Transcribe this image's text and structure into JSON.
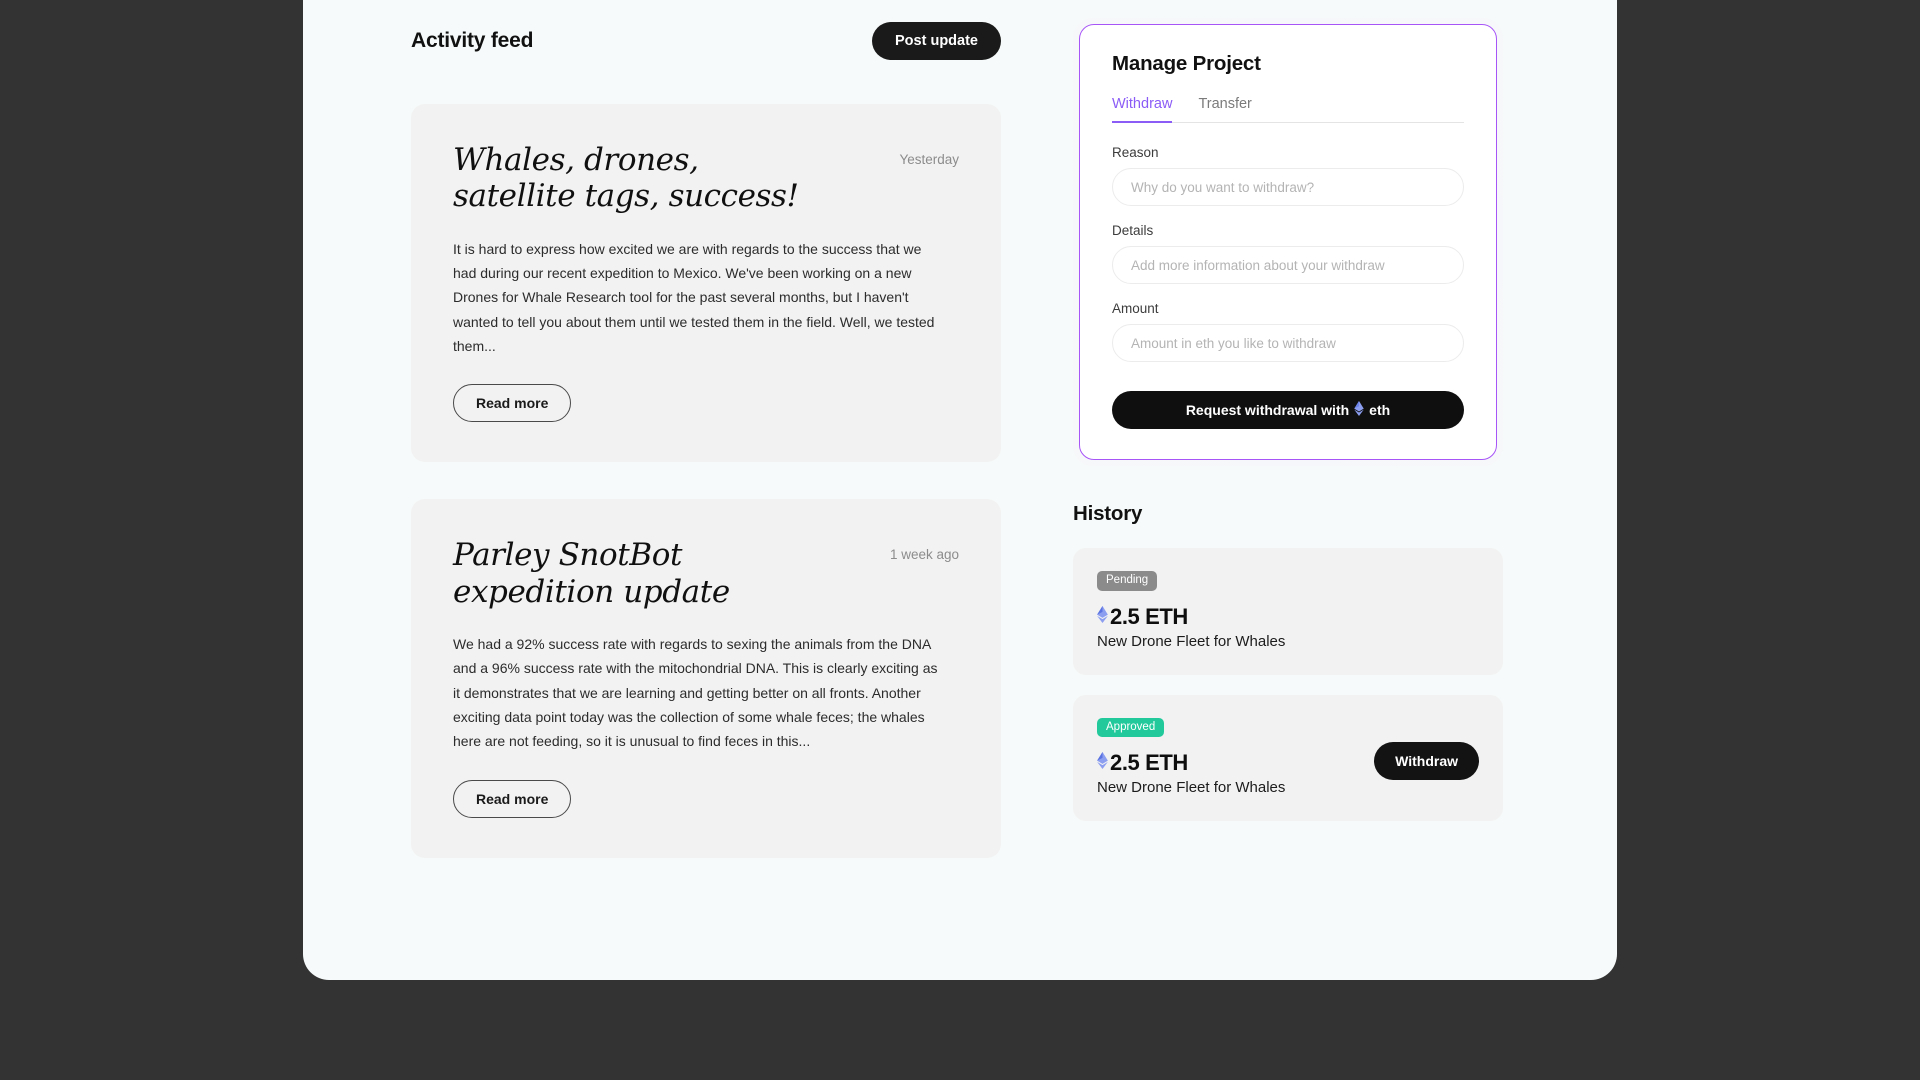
{
  "colors": {
    "page_bg": "#F7FAFA",
    "outer_bg": "#333333",
    "card_bg": "#F2F2F2",
    "accent_purple": "#8B5CF6",
    "border_purple": "#A855F7",
    "badge_pending": "#8B8B8B",
    "badge_approved": "#22C99B",
    "eth_blue": "#627EEA",
    "dark_button": "#131313"
  },
  "feed": {
    "title": "Activity feed",
    "post_update_label": "Post update",
    "posts": [
      {
        "title_line1": "Whales, drones,",
        "title_line2": "satellite tags, success!",
        "date": "Yesterday",
        "body": "It is hard to express how excited we are with regards to the success that we had during our recent expedition to Mexico. We've been working on a new Drones for Whale Research tool for the past several months, but I haven't wanted to tell you about them until we tested them in the field. Well, we tested them...",
        "read_more_label": "Read more"
      },
      {
        "title_line1": "Parley SnotBot",
        "title_line2": "expedition update",
        "date": "1 week ago",
        "body": "We had a 92% success rate with regards to sexing the animals from the DNA and a 96% success rate with the mitochondrial DNA. This is clearly exciting as it demonstrates that we are learning and getting better on all fronts. Another exciting data point today was the collection of some whale feces; the whales here are not feeding, so it is unusual to find feces in this...",
        "read_more_label": "Read more"
      }
    ]
  },
  "manage": {
    "title": "Manage Project",
    "tabs": [
      {
        "label": "Withdraw",
        "active": true
      },
      {
        "label": "Transfer",
        "active": false
      }
    ],
    "fields": [
      {
        "label": "Reason",
        "value": "",
        "placeholder": "Why do you want to withdraw?"
      },
      {
        "label": "Details",
        "value": "",
        "placeholder": "Add more information about your withdraw"
      },
      {
        "label": "Amount",
        "value": "",
        "placeholder": "Amount in eth you like to withdraw"
      }
    ],
    "submit_prefix": "Request withdrawal  with",
    "submit_suffix": "eth"
  },
  "history": {
    "title": "History",
    "entries": [
      {
        "status": "Pending",
        "amount": "2.5 ETH",
        "description": "New Drone Fleet for Whales",
        "action_label": null
      },
      {
        "status": "Approved",
        "amount": "2.5 ETH",
        "description": "New Drone Fleet for Whales",
        "action_label": "Withdraw"
      }
    ]
  }
}
